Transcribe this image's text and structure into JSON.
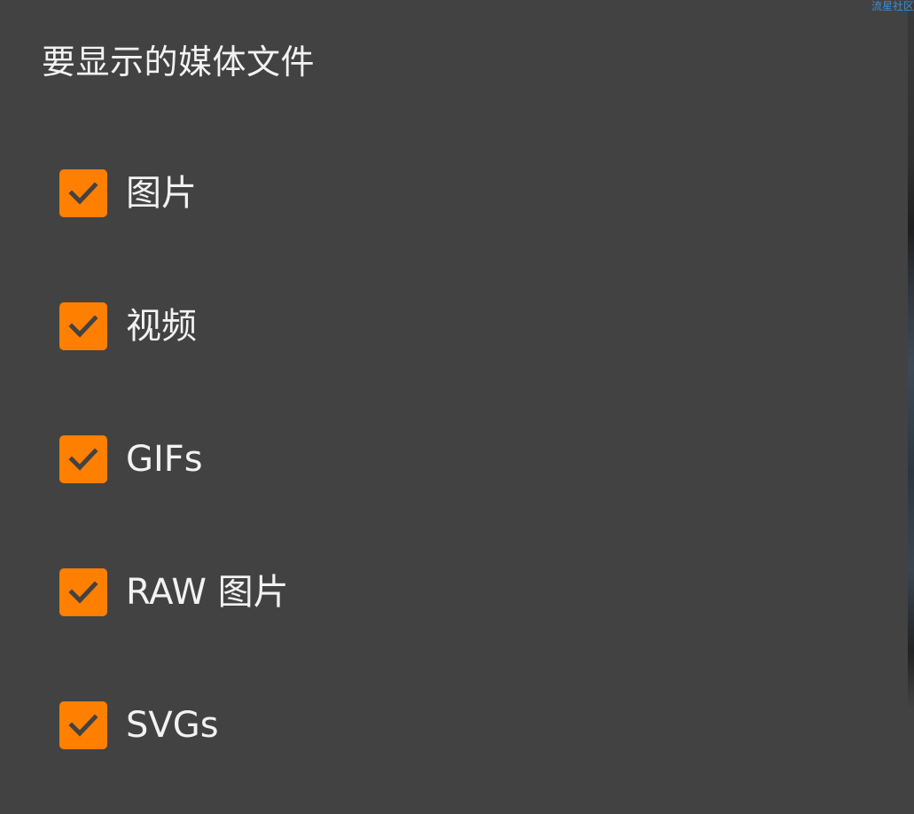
{
  "watermark": "流星社区",
  "dialog": {
    "title": "要显示的媒体文件"
  },
  "options": [
    {
      "label": "图片",
      "checked": true
    },
    {
      "label": "视频",
      "checked": true
    },
    {
      "label": "GIFs",
      "checked": true
    },
    {
      "label": "RAW 图片",
      "checked": true
    },
    {
      "label": "SVGs",
      "checked": true
    }
  ],
  "colors": {
    "background": "#424242",
    "accent": "#ff7f00",
    "text": "#f2f2f2",
    "checkmark": "#424242"
  }
}
